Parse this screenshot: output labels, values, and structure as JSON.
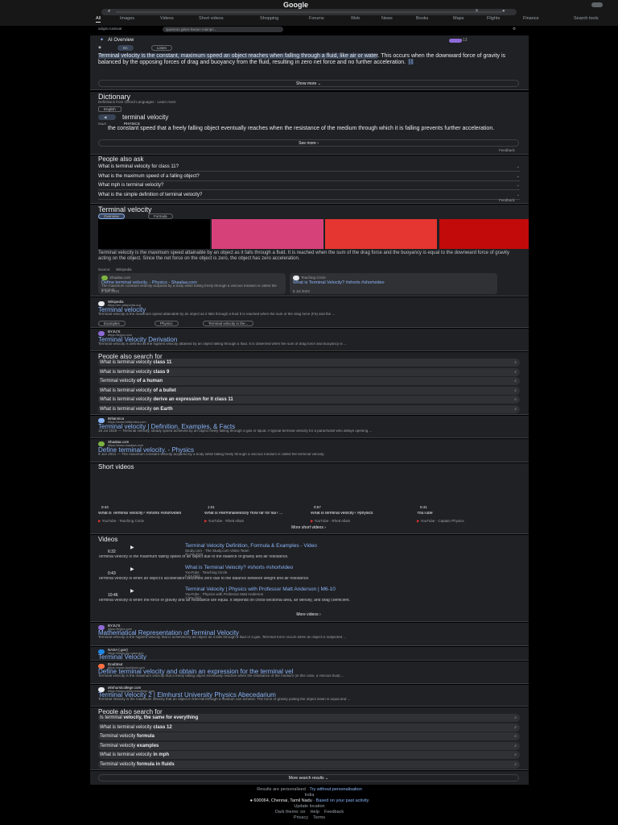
{
  "header": {
    "logo": "Google",
    "tabs": [
      "All",
      "Images",
      "Videos",
      "Short videos",
      "Shopping",
      "Forums",
      "Web",
      "News",
      "Books",
      "Maps",
      "Flights",
      "Finance",
      "Search tools"
    ],
    "chips": [
      "adigilo kastwat",
      "quamaru gilwo-kwaun mainpn...",
      "Q"
    ]
  },
  "ai_overview": {
    "title": "AI Overview",
    "chips": [
      "En",
      "Listen"
    ],
    "highlight": "Terminal velocity is the constant, maximum speed an object reaches when falling through a fluid, like air or water",
    "text_rest": ". This occurs when the downward force of gravity is balanced by the opposing forces of drag and buoyancy from the fluid, resulting in zero net force and no further acceleration.",
    "show_more": "Show more",
    "sources": "+13"
  },
  "dictionary": {
    "title": "Dictionary",
    "sub": "Definitions from Oxford Languages · Learn more",
    "lang": "English",
    "word": "terminal velocity",
    "pos": "noun",
    "pos2": "PHYSICS",
    "definition": "the constant speed that a freely falling object eventually reaches when the resistance of the medium through which it is falling prevents further acceleration.",
    "see_more": "See more",
    "feedback": "Feedback"
  },
  "paa1": {
    "title": "People also ask",
    "questions": [
      "What is terminal velocity for class 11?",
      "What is the maximum speed of a falling object?",
      "What mph is terminal velocity?",
      "What is the simple definition of terminal velocity?"
    ],
    "feedback": "Feedback"
  },
  "kp": {
    "title": "Terminal velocity",
    "tabs": [
      "Overview",
      "Formula"
    ],
    "colors": [
      "#000000",
      "#d6417a",
      "#e53631",
      "#c20a0a"
    ],
    "desc": "Terminal velocity is the maximum speed attainable by an object as it falls through a fluid. It is reached when the sum of the drag force and the buoyancy is equal to the downward force of gravity acting on the object. Since the net force on the object is zero, the object has zero acceleration.",
    "source_label": "Source:",
    "source": "Wikipedia",
    "cards": [
      {
        "site": "Shaalaa.com",
        "title": "Define terminal velocity. - Physics - Shaalaa.com",
        "snippet": "The maximum constant velocity acquired by a body while falling freely through a viscous medium is called the terminal",
        "date": "9 Jun 2021"
      },
      {
        "site": "Teaching Circle",
        "title": "What is Terminal Velocity? #shorts #shortvideo",
        "snippet": "",
        "date": "6 Jul 2023"
      }
    ]
  },
  "results1": [
    {
      "site": "Wikipedia",
      "url": "https://en.wikipedia.org",
      "title": "Terminal velocity",
      "snippet": "Terminal velocity is the maximum speed attainable by an object as it falls through a fluid It is reached when the sum of the drag force (Fd) and the ...",
      "chips": [
        "Examples",
        "Physics",
        "Terminal velocity in the..."
      ]
    },
    {
      "site": "BYJU'S",
      "url": "https://byjus.com",
      "title": "Terminal Velocity Derivation",
      "snippet": "Terminal velocity is defined as the highest velocity attained by an object falling through a fluid. It is observed when the sum of drag force and buoyancy is ..."
    }
  ],
  "pass1": {
    "title": "People also search for",
    "items": [
      [
        "What is terminal velocity ",
        "class 11"
      ],
      [
        "What is terminal velocity ",
        "class 9"
      ],
      [
        "Terminal velocity ",
        "of a human"
      ],
      [
        "What is terminal velocity ",
        "of a bullet"
      ],
      [
        "What is terminal velocity ",
        "derive an expression for it class 11"
      ],
      [
        "What is terminal velocity ",
        "on Earth"
      ]
    ]
  },
  "results2": [
    {
      "site": "Britannica",
      "url": "https://www.britannica.com",
      "title": "Terminal velocity | Definition, Examples, & Facts",
      "snippet": "18 Jul 2025 — Terminal velocity, steady speed achieved by an object freely falling through a gas or liquid. A typical terminal velocity for a parachutist who delays opening ..."
    },
    {
      "site": "Shaalaa.com",
      "url": "https://www.shaalaa.com",
      "title": "Define terminal velocity. - Physics",
      "snippet": "9 Jun 2021 — The maximum constant velocity acquired by a body while falling freely through a viscous medium is called the terminal velocity."
    }
  ],
  "shorts": {
    "title": "Short videos",
    "items": [
      {
        "dur": "0:43",
        "title": "What is Terminal Velocity? #shorts #shortvideo",
        "src": "YouTube · Teaching Circle"
      },
      {
        "dur": "1:01",
        "title": "What is #terminalvelocity How far for fall? ...",
        "src": "YouTube · Rhett Allain"
      },
      {
        "dur": "0:57",
        "title": "What is terminal velocity? #physics",
        "src": "YouTube · Rhett Allain"
      },
      {
        "dur": "0:41",
        "title": "YouTube",
        "src": "YouTube · Captain Physics"
      }
    ],
    "more": "More short videos"
  },
  "videos": {
    "title": "Videos",
    "items": [
      {
        "dur": "6:32",
        "title": "Terminal Velocity Definition, Formula & Examples - Video",
        "src": "Study.com · The Study.com Video Team",
        "date": "20 Jan 2024",
        "snippet": "Terminal velocity is the maximum falling speed of an object due to the balance of gravity and air resistance."
      },
      {
        "dur": "0:43",
        "title": "What is Terminal Velocity? #shorts #shortvideo",
        "src": "YouTube · Teaching Circle",
        "date": "6 Jul 2023",
        "snippet": "Terminal velocity is when an object's acceleration becomes zero due to the balance between weight and air resistance."
      },
      {
        "dur": "10:46",
        "title": "Terminal Velocity | Physics with Professor Matt Anderson | M6-10",
        "src": "YouTube · Physics with Professor Matt Anderson",
        "date": "1 Nov 2021",
        "snippet": "Terminal velocity is when the force of gravity and air resistance are equal. It depends on cross-sectional area, air density, and drag coefficient."
      }
    ],
    "more": "More videos"
  },
  "results3": [
    {
      "site": "BYJU'S",
      "url": "https://byjus.com",
      "title": "Mathematical Representation of Terminal Velocity",
      "snippet": "Terminal velocity is the highest velocity that is achieved by an object as it falls through a fluid or a gas. Terminal force occurs when an object is subjected ..."
    },
    {
      "site": "NASA (.gov)",
      "url": "https://www.grc.nasa.gov",
      "title": "Terminal Velocity",
      "snippet": ""
    },
    {
      "site": "Doubtnut",
      "url": "https://www.doubtnut.com",
      "title": "Define terminal velocity and obtain an expression for the terminal vel",
      "snippet": "Terminal velocity is the maximum velocity that a freely falling object eventually reaches when the resistance of the medium (in this case, a viscous fluid) ..."
    },
    {
      "site": "elmhurstcollege.com",
      "url": "https://www.elmhurstcollege.com",
      "title": "Terminal Velocity 2 | Elmhurst University Physics Abecedarium",
      "snippet": "Terminal Velocity is the maximum velocity that an object in free-fall through a medium can achieve. The force of gravity pulling the object down is equal and ..."
    }
  ],
  "pass2": {
    "title": "People also search for",
    "items": [
      [
        "Is terminal ",
        "velocity, the same for everything"
      ],
      [
        "What is terminal velocity ",
        "class 12"
      ],
      [
        "Terminal velocity ",
        "formula"
      ],
      [
        "Terminal velocity ",
        "examples"
      ],
      [
        "What is terminal velocity ",
        "in mph"
      ],
      [
        "Terminal velocity ",
        "formula in fluids"
      ]
    ]
  },
  "more_results": "More search results",
  "footer": {
    "line1a": "Results are personalised · ",
    "line1b": "Try without personalisation",
    "country": "India",
    "location": "600064, Chennai, Tamil Nadu",
    "loc_link": " · Based on your past activity",
    "update": "Update location",
    "links": [
      "Dark theme: on",
      "Help",
      "Feedback"
    ],
    "links2": [
      "Privacy",
      "Terms"
    ]
  }
}
